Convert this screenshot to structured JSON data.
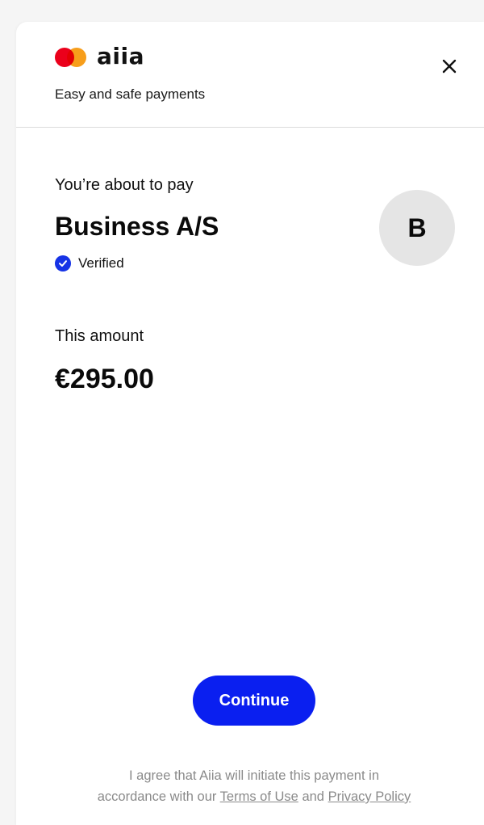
{
  "header": {
    "brand_name": "aiia",
    "tagline": "Easy and safe payments",
    "logo_icon": "mastercard-logo-icon",
    "close_icon": "close-icon",
    "colors": {
      "mc_red": "#eb001b",
      "mc_orange": "#f79e1b"
    }
  },
  "payment": {
    "intro": "You’re about to pay",
    "merchant_name": "Business A/S",
    "verified_label": "Verified",
    "verified_icon": "check-circle-icon",
    "avatar_initial": "B",
    "amount_label": "This amount",
    "amount": "€295.00"
  },
  "actions": {
    "continue_label": "Continue",
    "accent_color": "#0a1ff0"
  },
  "legal": {
    "line1": "I agree that Aiia will initiate this payment in",
    "line2_prefix": "accordance with our ",
    "terms_link": "Terms of Use",
    "and_text": " and ",
    "privacy_link": "Privacy Policy"
  }
}
